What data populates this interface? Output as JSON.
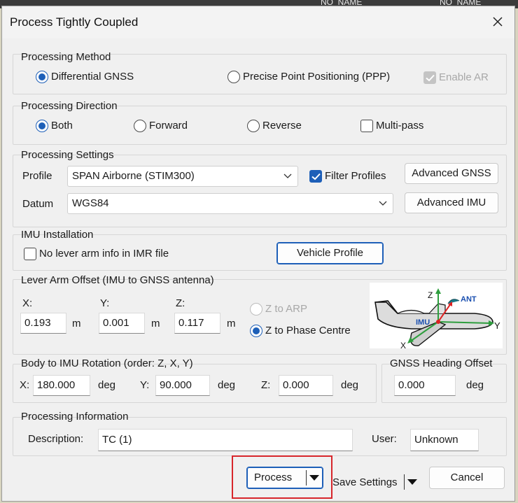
{
  "background": {
    "tag1": "NO_NAME",
    "tag2": "NO_NAME"
  },
  "dialog": {
    "title": "Process Tightly Coupled",
    "close_icon": "close-icon"
  },
  "processing_method": {
    "legend": "Processing Method",
    "differential_gnss": "Differential GNSS",
    "ppp": "Precise Point Positioning (PPP)",
    "enable_ar": "Enable AR",
    "selected": "Differential GNSS",
    "enable_ar_checked": true,
    "enable_ar_disabled": true
  },
  "processing_direction": {
    "legend": "Processing Direction",
    "both": "Both",
    "forward": "Forward",
    "reverse": "Reverse",
    "multi_pass": "Multi-pass",
    "selected": "Both",
    "multi_pass_checked": false
  },
  "processing_settings": {
    "legend": "Processing Settings",
    "profile_label": "Profile",
    "profile_value": "SPAN Airborne (STIM300)",
    "filter_profiles": "Filter Profiles",
    "filter_profiles_checked": true,
    "advanced_gnss": "Advanced GNSS",
    "datum_label": "Datum",
    "datum_value": "WGS84",
    "advanced_imu": "Advanced IMU"
  },
  "imu_installation": {
    "legend": "IMU Installation",
    "no_lever_arm": "No lever arm info in IMR file",
    "no_lever_arm_checked": false,
    "vehicle_profile": "Vehicle Profile"
  },
  "lever_arm": {
    "legend": "Lever Arm Offset (IMU to GNSS antenna)",
    "x_label": "X:",
    "x_value": "0.193",
    "y_label": "Y:",
    "y_value": "0.001",
    "z_label": "Z:",
    "z_value": "0.117",
    "unit": "m",
    "z_to_arp": "Z to ARP",
    "z_to_phase_centre": "Z to Phase Centre",
    "selected": "Z to Phase Centre",
    "diagram": {
      "z": "Z",
      "ant": "ANT",
      "imu": "IMU",
      "y": "Y",
      "x": "X"
    }
  },
  "body_rotation": {
    "legend": "Body to IMU Rotation (order: Z, X, Y)",
    "x_label": "X:",
    "x_value": "180.000",
    "y_label": "Y:",
    "y_value": "90.000",
    "z_label": "Z:",
    "z_value": "0.000",
    "unit": "deg"
  },
  "heading_offset": {
    "legend": "GNSS Heading Offset",
    "value": "0.000",
    "unit": "deg"
  },
  "processing_info": {
    "legend": "Processing Information",
    "description_label": "Description:",
    "description_value": "TC (1)",
    "user_label": "User:",
    "user_value": "Unknown"
  },
  "footer": {
    "process": "Process",
    "save_settings": "Save Settings",
    "cancel": "Cancel"
  },
  "colors": {
    "accent": "#1d5fb8",
    "highlight": "#d7262b"
  }
}
